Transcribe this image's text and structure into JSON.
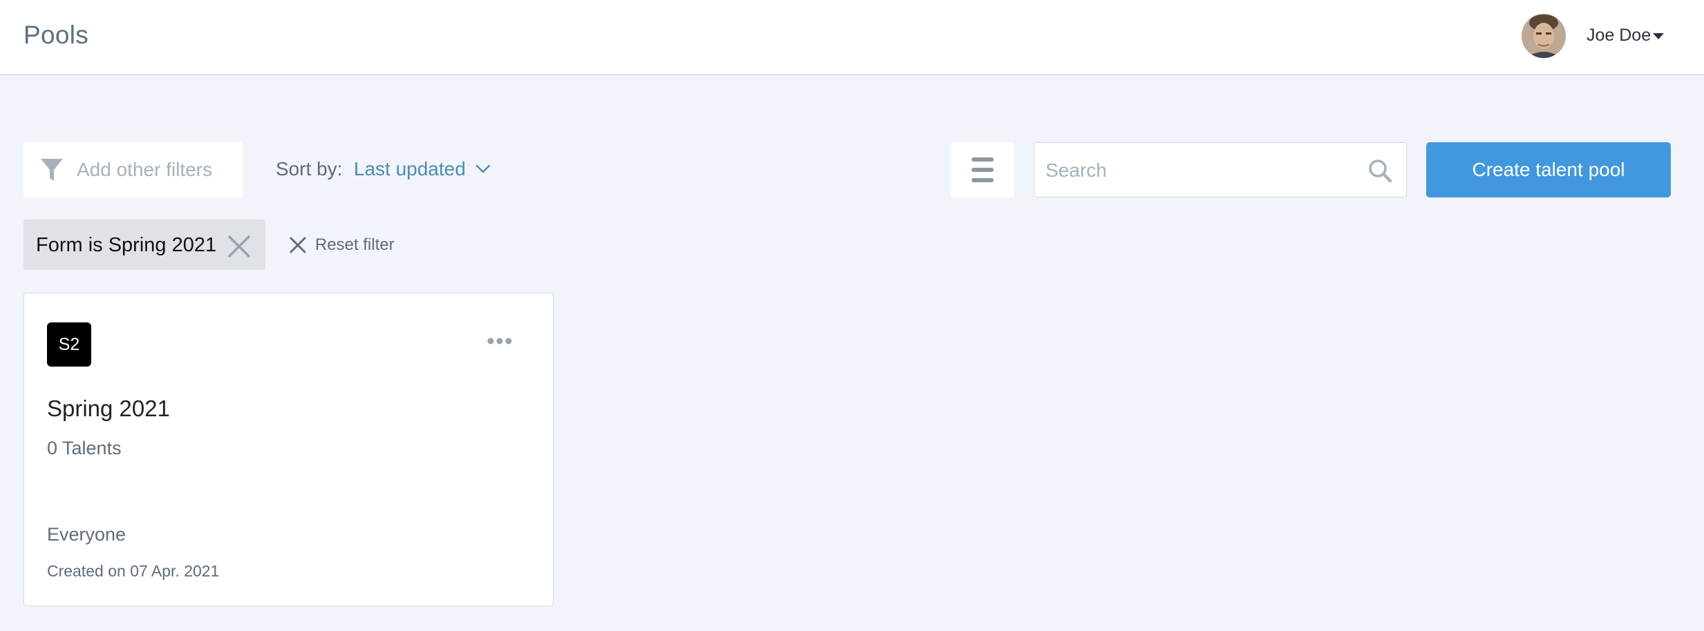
{
  "header": {
    "title": "Pools",
    "user": {
      "name": "Joe Doe",
      "avatar_icon": "user-avatar"
    }
  },
  "toolbar": {
    "filter_placeholder": "Add other filters",
    "sort_label": "Sort by:",
    "sort_value": "Last updated",
    "search_placeholder": "Search",
    "create_label": "Create talent pool"
  },
  "active_filters": {
    "chips": [
      {
        "label": "Form is Spring 2021"
      }
    ],
    "reset_label": "Reset filter"
  },
  "pools": [
    {
      "badge": "S2",
      "name": "Spring 2021",
      "count": "0 Talents",
      "audience": "Everyone",
      "created": "Created on 07 Apr. 2021"
    }
  ],
  "colors": {
    "background": "#f1f4fa",
    "primary": "#4298dc",
    "link": "#4b8db3",
    "chip": "#dfe2e6",
    "badge": "#000000"
  }
}
